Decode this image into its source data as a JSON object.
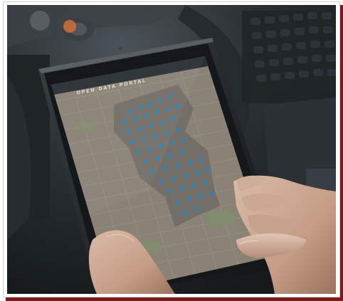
{
  "scene": {
    "subject": "hand-holding-smartphone",
    "background": "car-interior-dashboard"
  },
  "phone_screen": {
    "header_title": "OPEN DATA PORTAL",
    "map_markers": "blue-dot-cluster"
  },
  "colors": {
    "frame_shadow": "#7a1a1a",
    "marker_blue": "#2f83b3",
    "map_base": "#8a8275",
    "map_highlight": "#6f6c66",
    "screen_header": "#2a2f33"
  }
}
